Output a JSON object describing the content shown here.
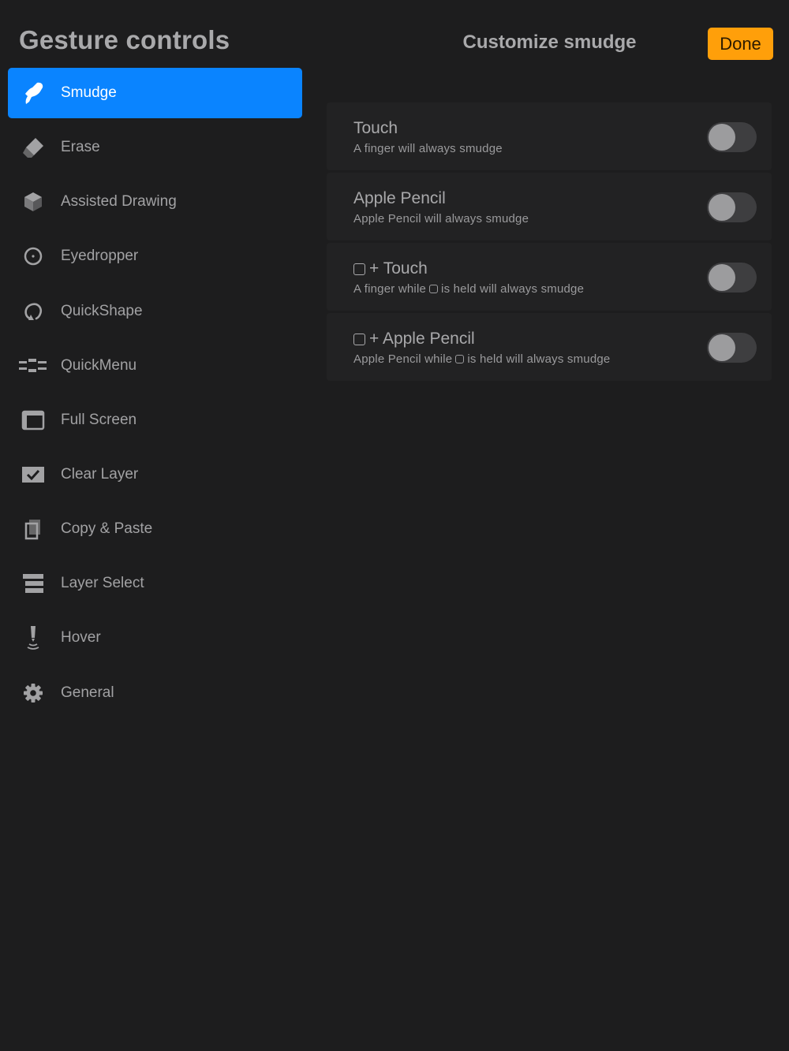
{
  "sidebar": {
    "title": "Gesture controls",
    "items": [
      {
        "label": "Smudge",
        "icon": "smudge-icon",
        "active": true
      },
      {
        "label": "Erase",
        "icon": "eraser-icon",
        "active": false
      },
      {
        "label": "Assisted Drawing",
        "icon": "cube-icon",
        "active": false
      },
      {
        "label": "Eyedropper",
        "icon": "eyedropper-icon",
        "active": false
      },
      {
        "label": "QuickShape",
        "icon": "quickshape-icon",
        "active": false
      },
      {
        "label": "QuickMenu",
        "icon": "quickmenu-icon",
        "active": false
      },
      {
        "label": "Full Screen",
        "icon": "full-screen-icon",
        "active": false
      },
      {
        "label": "Clear Layer",
        "icon": "clear-layer-icon",
        "active": false
      },
      {
        "label": "Copy & Paste",
        "icon": "copy-paste-icon",
        "active": false
      },
      {
        "label": "Layer Select",
        "icon": "layer-select-icon",
        "active": false
      },
      {
        "label": "Hover",
        "icon": "hover-icon",
        "active": false
      },
      {
        "label": "General",
        "icon": "gear-icon",
        "active": false
      }
    ]
  },
  "header": {
    "title": "Customize smudge",
    "done_label": "Done"
  },
  "settings": {
    "rows": [
      {
        "title": "Touch",
        "description": "A finger will always smudge",
        "enabled": false
      },
      {
        "title": "Apple Pencil",
        "description": "Apple Pencil will always smudge",
        "enabled": false
      },
      {
        "title": "+ Touch",
        "desc_before": "A finger while",
        "desc_after": "is held will always smudge",
        "enabled": false
      },
      {
        "title": "+ Apple Pencil",
        "desc_before": "Apple Pencil while",
        "desc_after": "is held will always smudge",
        "enabled": false
      }
    ]
  },
  "colors": {
    "background": "#1d1d1e",
    "accent": "#0a84ff",
    "done_button": "#ff9f0a"
  }
}
